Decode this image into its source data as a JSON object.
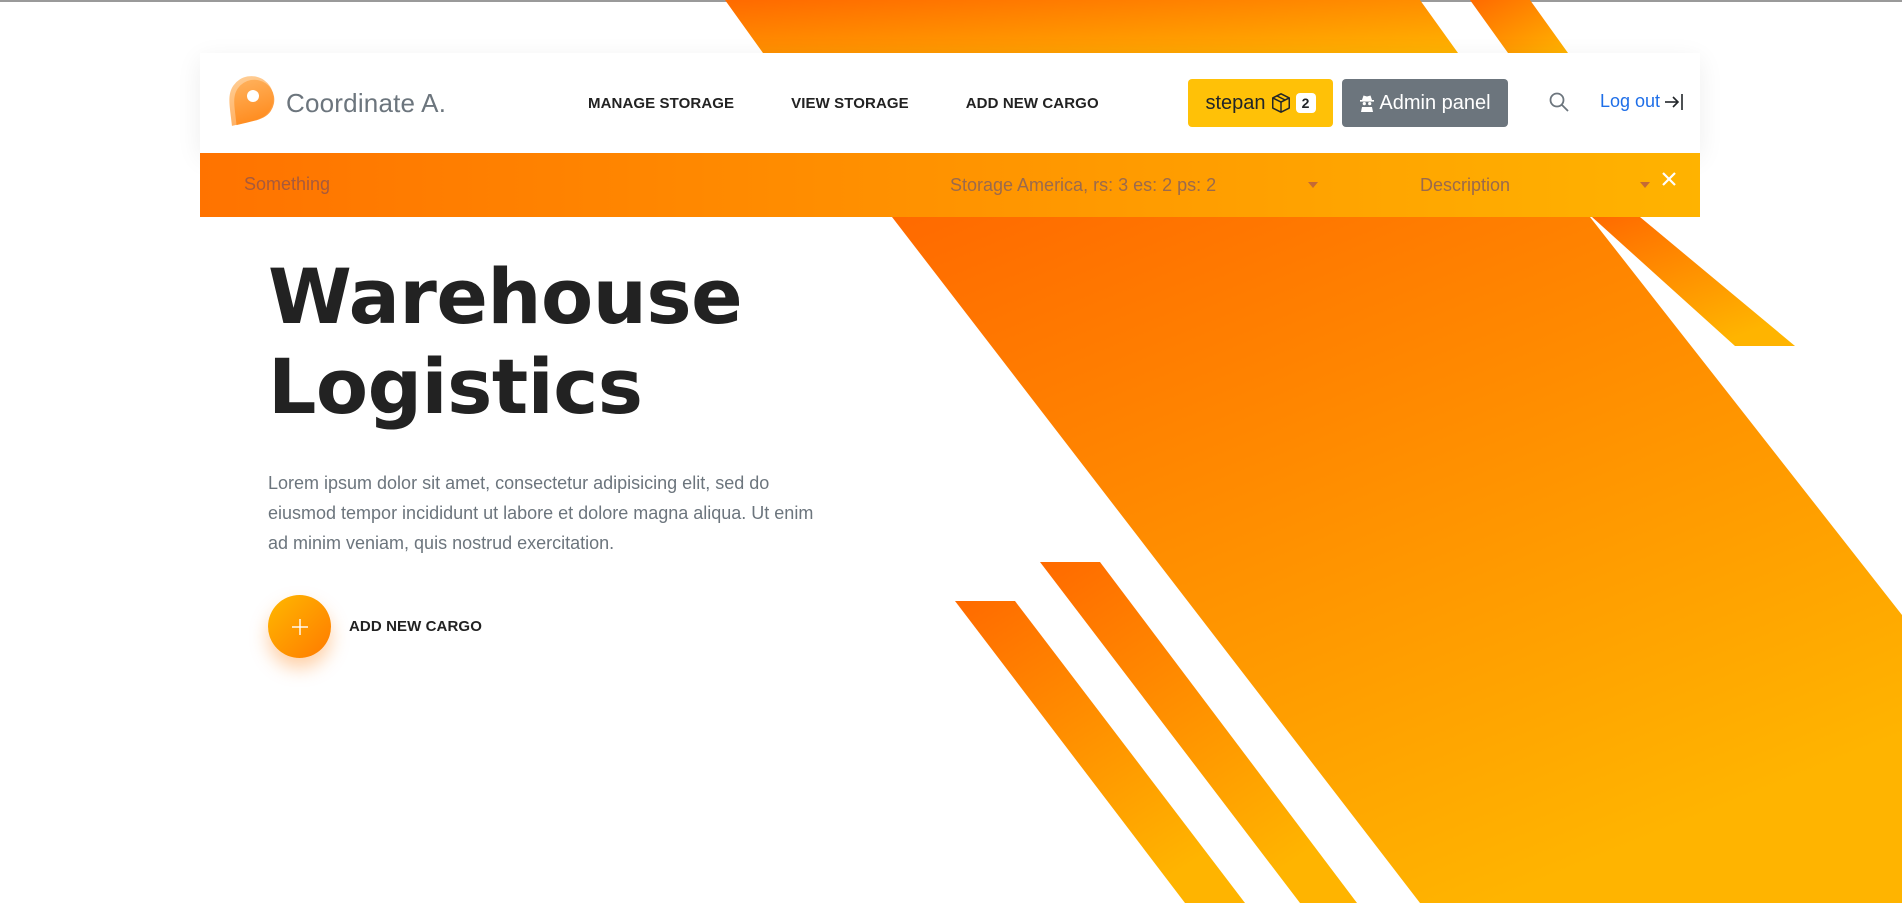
{
  "brand": {
    "name": "Coordinate A.",
    "logo_icon": "location-pin-icon"
  },
  "nav": {
    "links": [
      "MANAGE STORAGE",
      "VIEW STORAGE",
      "ADD NEW CARGO"
    ]
  },
  "user": {
    "name": "stepan",
    "cargo_icon": "box-icon",
    "count": "2"
  },
  "admin": {
    "label": "Admin panel",
    "icon": "spy-icon"
  },
  "search": {
    "icon": "search-icon"
  },
  "logout": {
    "label": "Log out",
    "icon": "logout-icon"
  },
  "filter": {
    "placeholder": "Something",
    "storage_select": "Storage America, rs: 3 es: 2 ps: 2",
    "description_select": "Description",
    "close_icon": "close-icon"
  },
  "hero": {
    "title_line1": "Warehouse",
    "title_line2": "Logistics",
    "text": "Lorem ipsum dolor sit amet, consectetur adipisicing elit, sed do eiusmod tempor incididunt ut labore et dolore magna aliqua. Ut enim ad minim veniam, quis nostrud exercitation.",
    "cta_label": "ADD NEW CARGO",
    "cta_icon": "plus-icon"
  },
  "colors": {
    "accent_start": "#ff6a00",
    "accent_end": "#ffb400",
    "badge_yellow": "#ffc107",
    "admin_gray": "#6c757d",
    "link_blue": "#1e6ee8"
  }
}
